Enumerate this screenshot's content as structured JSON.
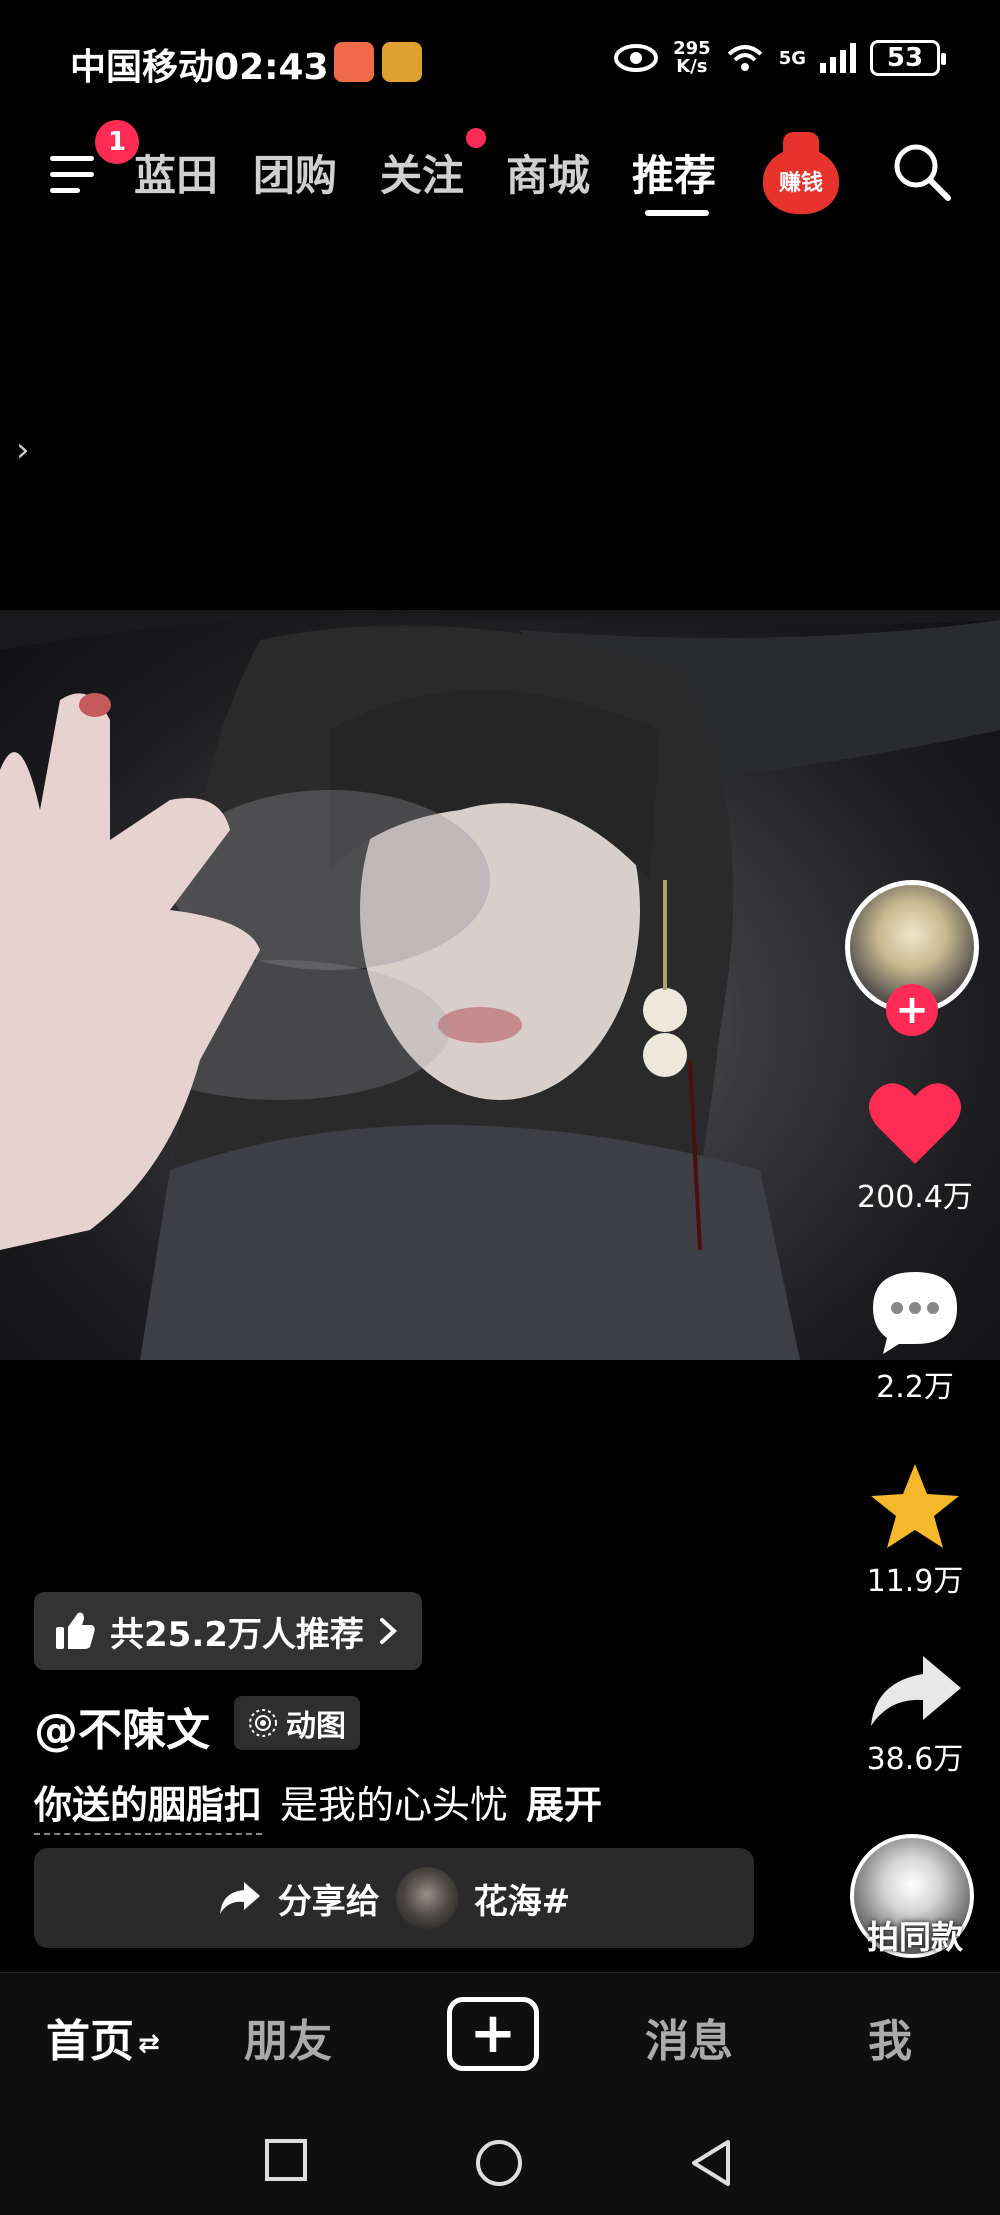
{
  "status_bar": {
    "carrier": "中国移动",
    "time": "02:43",
    "speed_value": "295",
    "speed_unit": "K/s",
    "network": "5G",
    "battery": "53"
  },
  "top_nav": {
    "menu_badge": "1",
    "tabs": [
      {
        "label": "蓝田"
      },
      {
        "label": "团购"
      },
      {
        "label": "关注"
      },
      {
        "label": "商城"
      },
      {
        "label": "推荐"
      }
    ],
    "earn_label": "赚钱",
    "accent": "#fe2c55"
  },
  "rail": {
    "likes": "200.4万",
    "comments": "2.2万",
    "favorites": "11.9万",
    "shares": "38.6万",
    "same_style": "拍同款"
  },
  "info": {
    "recommend_text": "共25.2万人推荐",
    "author": "@不陳文",
    "tag": "动图",
    "desc_highlight": "你送的胭脂扣",
    "desc_text": "是我的心头忧",
    "desc_more": "展开",
    "share_label": "分享给",
    "share_target": "花海#"
  },
  "bottom_tabs": {
    "home": "首页",
    "home_arrows": "⇄",
    "friends": "朋友",
    "messages": "消息",
    "me": "我"
  }
}
